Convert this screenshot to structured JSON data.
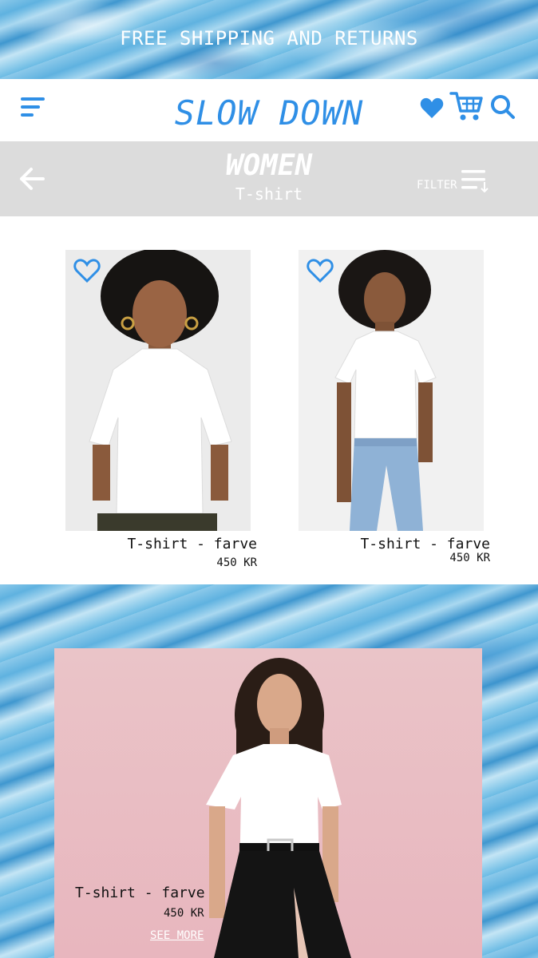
{
  "promo": {
    "text": "FREE SHIPPING AND RETURNS"
  },
  "header": {
    "brand": "SLOW DOWN",
    "icons": [
      "menu-icon",
      "heart-icon",
      "cart-icon",
      "search-icon"
    ]
  },
  "category": {
    "title": "WOMEN",
    "subtitle": "T-shirt",
    "filter_label": "FILTER",
    "icons": [
      "back-arrow-icon",
      "filter-sort-icon"
    ]
  },
  "products": [
    {
      "name": "T-shirt - farve",
      "price": "450 KR"
    },
    {
      "name": "T-shirt - farve",
      "price": "450 KR"
    }
  ],
  "featured": {
    "name": "T-shirt - farve",
    "price": "450 KR",
    "link": "SEE MORE"
  },
  "colors": {
    "accent": "#2f8fe6",
    "category_bar": "#dcdcdc",
    "text": "#111111"
  }
}
